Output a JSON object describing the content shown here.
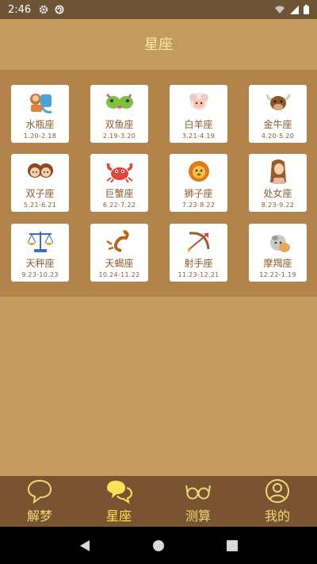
{
  "status": {
    "time": "2:46"
  },
  "header": {
    "title": "星座"
  },
  "zodiac": [
    {
      "name": "水瓶座",
      "date": "1.20-2.18",
      "icon": "aquarius-icon"
    },
    {
      "name": "双鱼座",
      "date": "2.19-3.20",
      "icon": "pisces-icon"
    },
    {
      "name": "白羊座",
      "date": "3.21-4.19",
      "icon": "aries-icon"
    },
    {
      "name": "金牛座",
      "date": "4.20-5.20",
      "icon": "taurus-icon"
    },
    {
      "name": "双子座",
      "date": "5.21-6.21",
      "icon": "gemini-icon"
    },
    {
      "name": "巨蟹座",
      "date": "6.22-7.22",
      "icon": "cancer-icon"
    },
    {
      "name": "狮子座",
      "date": "7.23-8.22",
      "icon": "leo-icon"
    },
    {
      "name": "处女座",
      "date": "8.23-9.22",
      "icon": "virgo-icon"
    },
    {
      "name": "天秤座",
      "date": "9.23-10.23",
      "icon": "libra-icon"
    },
    {
      "name": "天蝎座",
      "date": "10.24-11.22",
      "icon": "scorpio-icon"
    },
    {
      "name": "射手座",
      "date": "11.23-12.21",
      "icon": "sagittarius-icon"
    },
    {
      "name": "摩羯座",
      "date": "12.22-1.19",
      "icon": "capricorn-icon"
    }
  ],
  "nav": [
    {
      "label": "解梦",
      "icon": "speech-bubble-icon",
      "active": false
    },
    {
      "label": "星座",
      "icon": "chat-bubbles-icon",
      "active": true
    },
    {
      "label": "测算",
      "icon": "glasses-icon",
      "active": false
    },
    {
      "label": "我的",
      "icon": "user-icon",
      "active": false
    }
  ],
  "colors": {
    "background": "#c49a5e",
    "panel": "#b3834c",
    "nav": "#7a5431",
    "accent": "#f0d87a"
  }
}
